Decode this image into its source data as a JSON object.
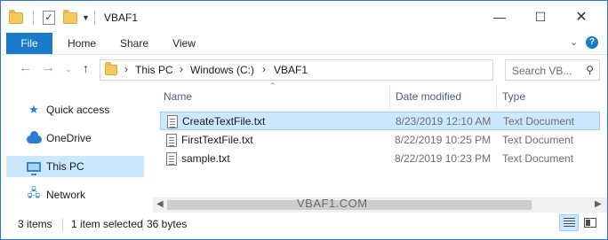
{
  "window": {
    "title": "VBAF1"
  },
  "ribbon": {
    "tabs": [
      "File",
      "Home",
      "Share",
      "View"
    ]
  },
  "nav": {
    "address": [
      "This PC",
      "Windows (C:)",
      "VBAF1"
    ],
    "search_placeholder": "Search VB..."
  },
  "sidebar": {
    "items": [
      {
        "label": "Quick access",
        "icon": "star-icon"
      },
      {
        "label": "OneDrive",
        "icon": "cloud-icon"
      },
      {
        "label": "This PC",
        "icon": "pc-icon"
      },
      {
        "label": "Network",
        "icon": "network-icon"
      }
    ]
  },
  "list": {
    "columns": {
      "name": "Name",
      "date": "Date modified",
      "type": "Type"
    },
    "rows": [
      {
        "name": "CreateTextFile.txt",
        "date": "8/23/2019 12:10 AM",
        "type": "Text Document"
      },
      {
        "name": "FirstTextFile.txt",
        "date": "8/22/2019 10:25 PM",
        "type": "Text Document"
      },
      {
        "name": "sample.txt",
        "date": "8/22/2019 10:23 PM",
        "type": "Text Document"
      }
    ]
  },
  "watermark": "VBAF1.COM",
  "status": {
    "items": "3 items",
    "selected": "1 item selected",
    "size": "36 bytes"
  },
  "colors": {
    "accent": "#1979ca",
    "selection": "#cce8ff"
  }
}
